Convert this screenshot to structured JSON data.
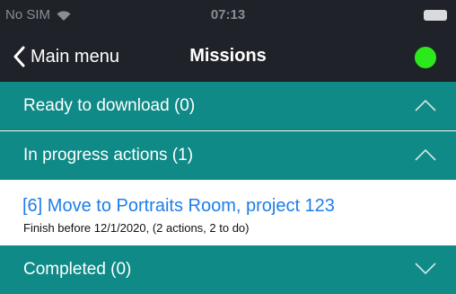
{
  "status_bar": {
    "carrier": "No SIM",
    "time": "07:13",
    "icons": [
      "wifi-icon",
      "battery-icon"
    ]
  },
  "nav": {
    "back_label": "Main menu",
    "title": "Missions",
    "status_color": "#2bea1b"
  },
  "sections": {
    "ready": {
      "label": "Ready to download (0)",
      "expanded": true
    },
    "in_progress": {
      "label": "In progress actions (1)",
      "expanded": true,
      "items": [
        {
          "title": "[6] Move to Portraits Room, project 123",
          "subtitle": "Finish before 12/1/2020, (2 actions, 2 to do)"
        }
      ]
    },
    "completed": {
      "label": "Completed (0)",
      "expanded": false
    }
  },
  "colors": {
    "bar_background": "#1f2329",
    "section_background": "#0f8a87",
    "link_blue": "#1e7ee8"
  }
}
